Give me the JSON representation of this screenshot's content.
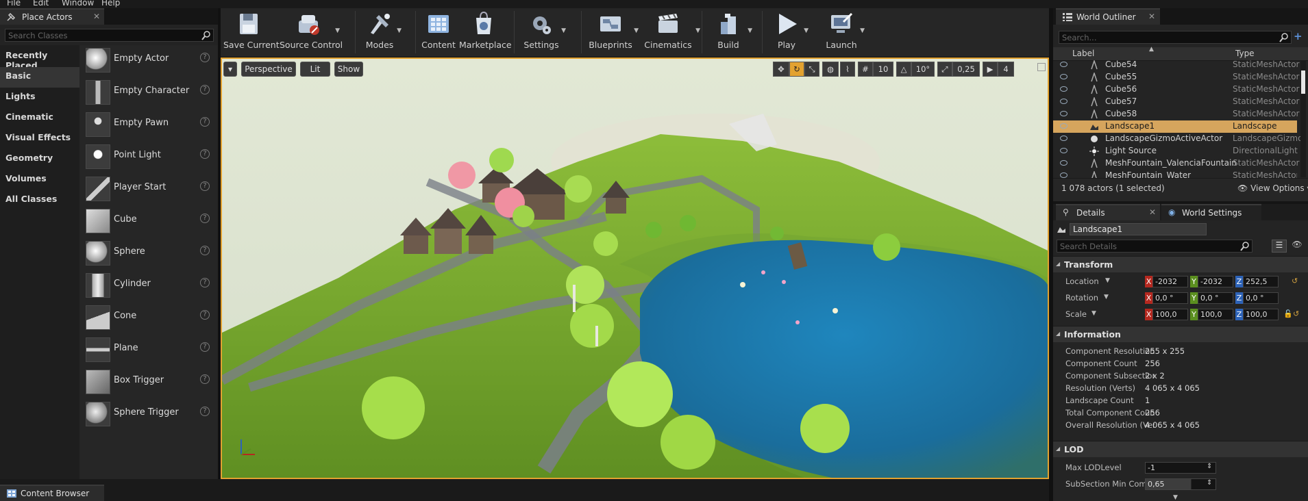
{
  "menu": [
    "File",
    "Edit",
    "Window",
    "Help"
  ],
  "place_actors": {
    "tab_title": "Place Actors",
    "search_placeholder": "Search Classes",
    "categories": [
      "Recently Placed",
      "Basic",
      "Lights",
      "Cinematic",
      "Visual Effects",
      "Geometry",
      "Volumes",
      "All Classes"
    ],
    "selected_category": "Basic",
    "items": [
      "Empty Actor",
      "Empty Character",
      "Empty Pawn",
      "Point Light",
      "Player Start",
      "Cube",
      "Sphere",
      "Cylinder",
      "Cone",
      "Plane",
      "Box Trigger",
      "Sphere Trigger"
    ],
    "help_glyph": "?"
  },
  "toolbar": {
    "buttons": [
      {
        "label": "Save Current",
        "icon": "save-icon"
      },
      {
        "label": "Source Control",
        "icon": "source-control-icon"
      },
      {
        "label": "Modes",
        "icon": "modes-icon"
      },
      {
        "label": "Content",
        "icon": "content-icon"
      },
      {
        "label": "Marketplace",
        "icon": "marketplace-icon"
      },
      {
        "label": "Settings",
        "icon": "settings-icon"
      },
      {
        "label": "Blueprints",
        "icon": "blueprints-icon"
      },
      {
        "label": "Cinematics",
        "icon": "cinematics-icon"
      },
      {
        "label": "Build",
        "icon": "build-icon"
      },
      {
        "label": "Play",
        "icon": "play-icon"
      },
      {
        "label": "Launch",
        "icon": "launch-icon"
      }
    ]
  },
  "viewport": {
    "perspective_label": "Perspective",
    "lit_label": "Lit",
    "show_label": "Show",
    "grid_snap": "10",
    "rotation_snap": "10°",
    "scale_snap": "0,25",
    "camera_speed": "4"
  },
  "world_outliner": {
    "tab_title": "World Outliner",
    "search_placeholder": "Search...",
    "col_label": "Label",
    "col_type": "Type",
    "rows": [
      {
        "label": "Cube54",
        "type": "StaticMeshActor"
      },
      {
        "label": "Cube55",
        "type": "StaticMeshActor"
      },
      {
        "label": "Cube56",
        "type": "StaticMeshActor"
      },
      {
        "label": "Cube57",
        "type": "StaticMeshActor"
      },
      {
        "label": "Cube58",
        "type": "StaticMeshActor"
      },
      {
        "label": "Landscape1",
        "type": "Landscape"
      },
      {
        "label": "LandscapeGizmoActiveActor",
        "type": "LandscapeGizmo"
      },
      {
        "label": "Light Source",
        "type": "DirectionalLight"
      },
      {
        "label": "MeshFountain_ValenciaFountain",
        "type": "StaticMeshActor"
      },
      {
        "label": "MeshFountain_Water",
        "type": "StaticMeshActor"
      }
    ],
    "selected_row": "Landscape1",
    "count_text": "1 078 actors (1 selected)",
    "view_options": "View Options"
  },
  "details": {
    "tab_title": "Details",
    "world_settings_tab": "World Settings",
    "actor_name": "Landscape1",
    "search_placeholder": "Search Details",
    "transform": {
      "title": "Transform",
      "location_label": "Location",
      "rotation_label": "Rotation",
      "scale_label": "Scale",
      "location": [
        "-2032",
        "-2032",
        "252,5"
      ],
      "rotation": [
        "0,0 °",
        "0,0 °",
        "0,0 °"
      ],
      "scale": [
        "100,0",
        "100,0",
        "100,0"
      ]
    },
    "information": {
      "title": "Information",
      "props": [
        {
          "label": "Component Resolution",
          "value": "255 x 255"
        },
        {
          "label": "Component Count",
          "value": "256"
        },
        {
          "label": "Component Subsections",
          "value": "2 x 2"
        },
        {
          "label": "Resolution (Verts)",
          "value": "4 065 x 4 065"
        },
        {
          "label": "Landscape Count",
          "value": "1"
        },
        {
          "label": "Total Component Count",
          "value": "256"
        },
        {
          "label": "Overall Resolution (Verts)",
          "value": "4 065 x 4 065"
        }
      ]
    },
    "lod": {
      "title": "LOD",
      "max_lod_label": "Max LODLevel",
      "max_lod_value": "-1",
      "subsection_label": "SubSection Min Component",
      "subsection_value": "0,65"
    }
  },
  "content_browser": {
    "tab_title": "Content Browser"
  },
  "colors": {
    "accent_orange": "#e3a230",
    "selection": "#d6a55d",
    "axis_x": "#b5281f",
    "axis_y": "#5b8f1f",
    "axis_z": "#2d63b8"
  }
}
